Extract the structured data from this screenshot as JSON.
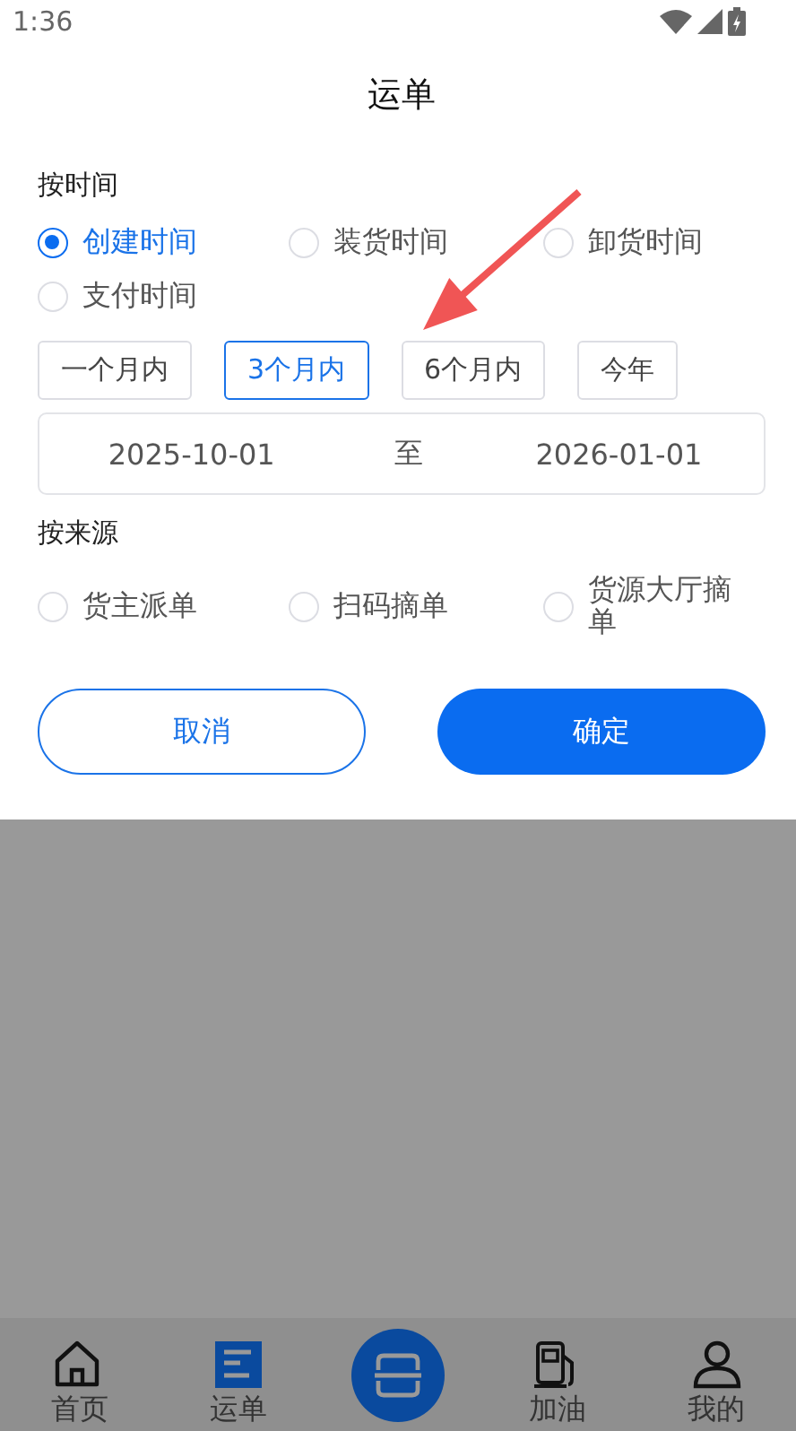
{
  "status_bar": {
    "time": "1:36"
  },
  "sheet": {
    "title": "运单",
    "time_section": {
      "label": "按时间",
      "options": [
        {
          "label": "创建时间",
          "selected": true
        },
        {
          "label": "装货时间",
          "selected": false
        },
        {
          "label": "卸货时间",
          "selected": false
        },
        {
          "label": "支付时间",
          "selected": false
        }
      ],
      "ranges": [
        {
          "label": "一个月内",
          "selected": false
        },
        {
          "label": "3个月内",
          "selected": true
        },
        {
          "label": "6个月内",
          "selected": false
        },
        {
          "label": "今年",
          "selected": false
        }
      ],
      "date_range": {
        "start": "2025-10-01",
        "separator": "至",
        "end": "2026-01-01"
      }
    },
    "source_section": {
      "label": "按来源",
      "options": [
        {
          "label": "货主派单",
          "selected": false
        },
        {
          "label": "扫码摘单",
          "selected": false
        },
        {
          "label": "货源大厅摘单",
          "selected": false
        }
      ]
    },
    "buttons": [
      {
        "label": "取消",
        "kind": "secondary"
      },
      {
        "label": "确定",
        "kind": "primary"
      }
    ]
  },
  "tab_bar": {
    "items": [
      {
        "kind": "home",
        "label": "首页",
        "selected": false
      },
      {
        "kind": "waybill",
        "label": "运单",
        "selected": true
      },
      {
        "kind": "scan",
        "selected": false
      },
      {
        "kind": "fuel",
        "label": "加油",
        "selected": false
      },
      {
        "kind": "profile",
        "label": "我的",
        "selected": false
      }
    ]
  }
}
